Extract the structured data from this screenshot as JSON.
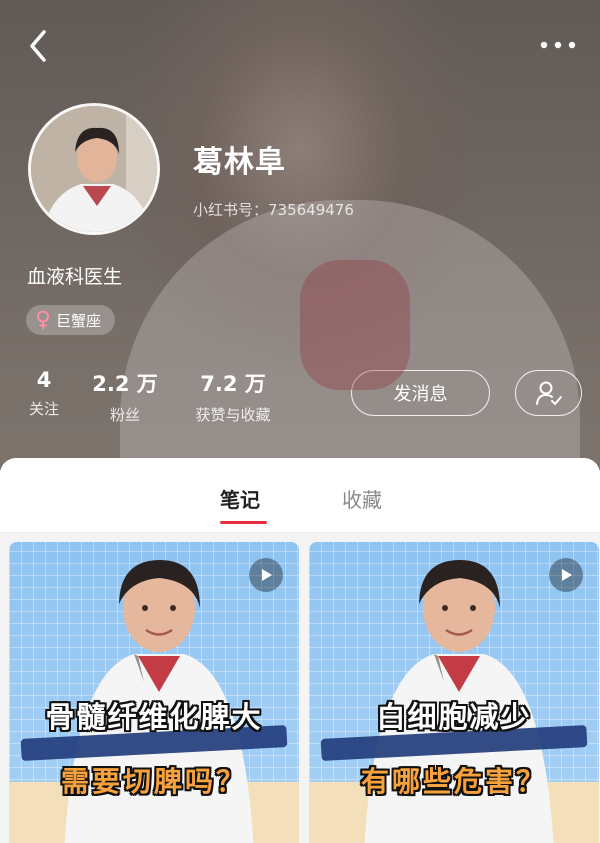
{
  "header": {
    "name": "葛林阜",
    "xhs_id": "小红书号：735649476",
    "bio": "血液科医生",
    "tag_label": "巨蟹座",
    "stats": [
      {
        "value": "4",
        "label": "关注"
      },
      {
        "value": "2.2 万",
        "label": "粉丝"
      },
      {
        "value": "7.2 万",
        "label": "获赞与收藏"
      }
    ],
    "message_label": "发消息"
  },
  "tabs": [
    {
      "label": "笔记",
      "active": true
    },
    {
      "label": "收藏",
      "active": false
    }
  ],
  "notes": [
    {
      "line1": "骨髓纤维化脾大",
      "line2": "需要切脾吗？"
    },
    {
      "line1": "白细胞减少",
      "line2": "有哪些危害？"
    }
  ],
  "colors": {
    "accent": "#e52f3c",
    "note_title_orange": "#f7a23c",
    "card_blue": "#8fc3f0"
  },
  "icons": [
    "back-icon",
    "more-icon",
    "female-icon",
    "follow-user-icon",
    "play-icon"
  ]
}
